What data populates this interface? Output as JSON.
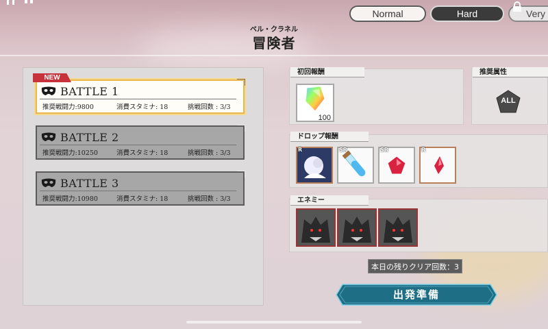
{
  "header": {
    "subtitle": "ベル・クラネル",
    "title": "冒険者",
    "difficulty_tabs": [
      {
        "label": "Normal",
        "state": "selected"
      },
      {
        "label": "Hard",
        "state": "available"
      },
      {
        "label": "Very",
        "state": "locked"
      }
    ]
  },
  "battles": [
    {
      "name": "BATTLE 1",
      "badge": "NEW",
      "power": "推奨戦闘力:9800",
      "stamina": "消費スタミナ: 18",
      "attempts": "挑戦回数 : 3/3",
      "active": true
    },
    {
      "name": "BATTLE 2",
      "power": "推奨戦闘力:10250",
      "stamina": "消費スタミナ: 18",
      "attempts": "挑戦回数 : 3/3",
      "active": false
    },
    {
      "name": "BATTLE 3",
      "power": "推奨戦闘力:10980",
      "stamina": "消費スタミナ: 18",
      "attempts": "挑戦回数 : 3/3",
      "active": false
    }
  ],
  "first_reward": {
    "label": "初回報酬",
    "quantity": "100",
    "icon": "rainbow-crystal-icon"
  },
  "recommended_attribute": {
    "label": "推奨属性",
    "value": "ALL"
  },
  "drop_rewards": {
    "label": "ドロップ報酬",
    "items": [
      {
        "rarity": "R",
        "icon": "character-card-icon"
      },
      {
        "rarity": "SR",
        "icon": "potion-vial-icon"
      },
      {
        "rarity": "SR",
        "icon": "red-gem-icon"
      },
      {
        "rarity": "R",
        "icon": "red-shard-icon"
      }
    ]
  },
  "enemies": {
    "label": "エネミー",
    "count": 3,
    "icon": "wolf-monster-icon"
  },
  "clear_count": "本日の残りクリア回数：3",
  "depart_button": "出発準備",
  "colors": {
    "accent_gold": "#e9b650",
    "new_badge": "#c7323b",
    "depart_button": "#1e6f86",
    "enemy_border": "#9a3434"
  }
}
